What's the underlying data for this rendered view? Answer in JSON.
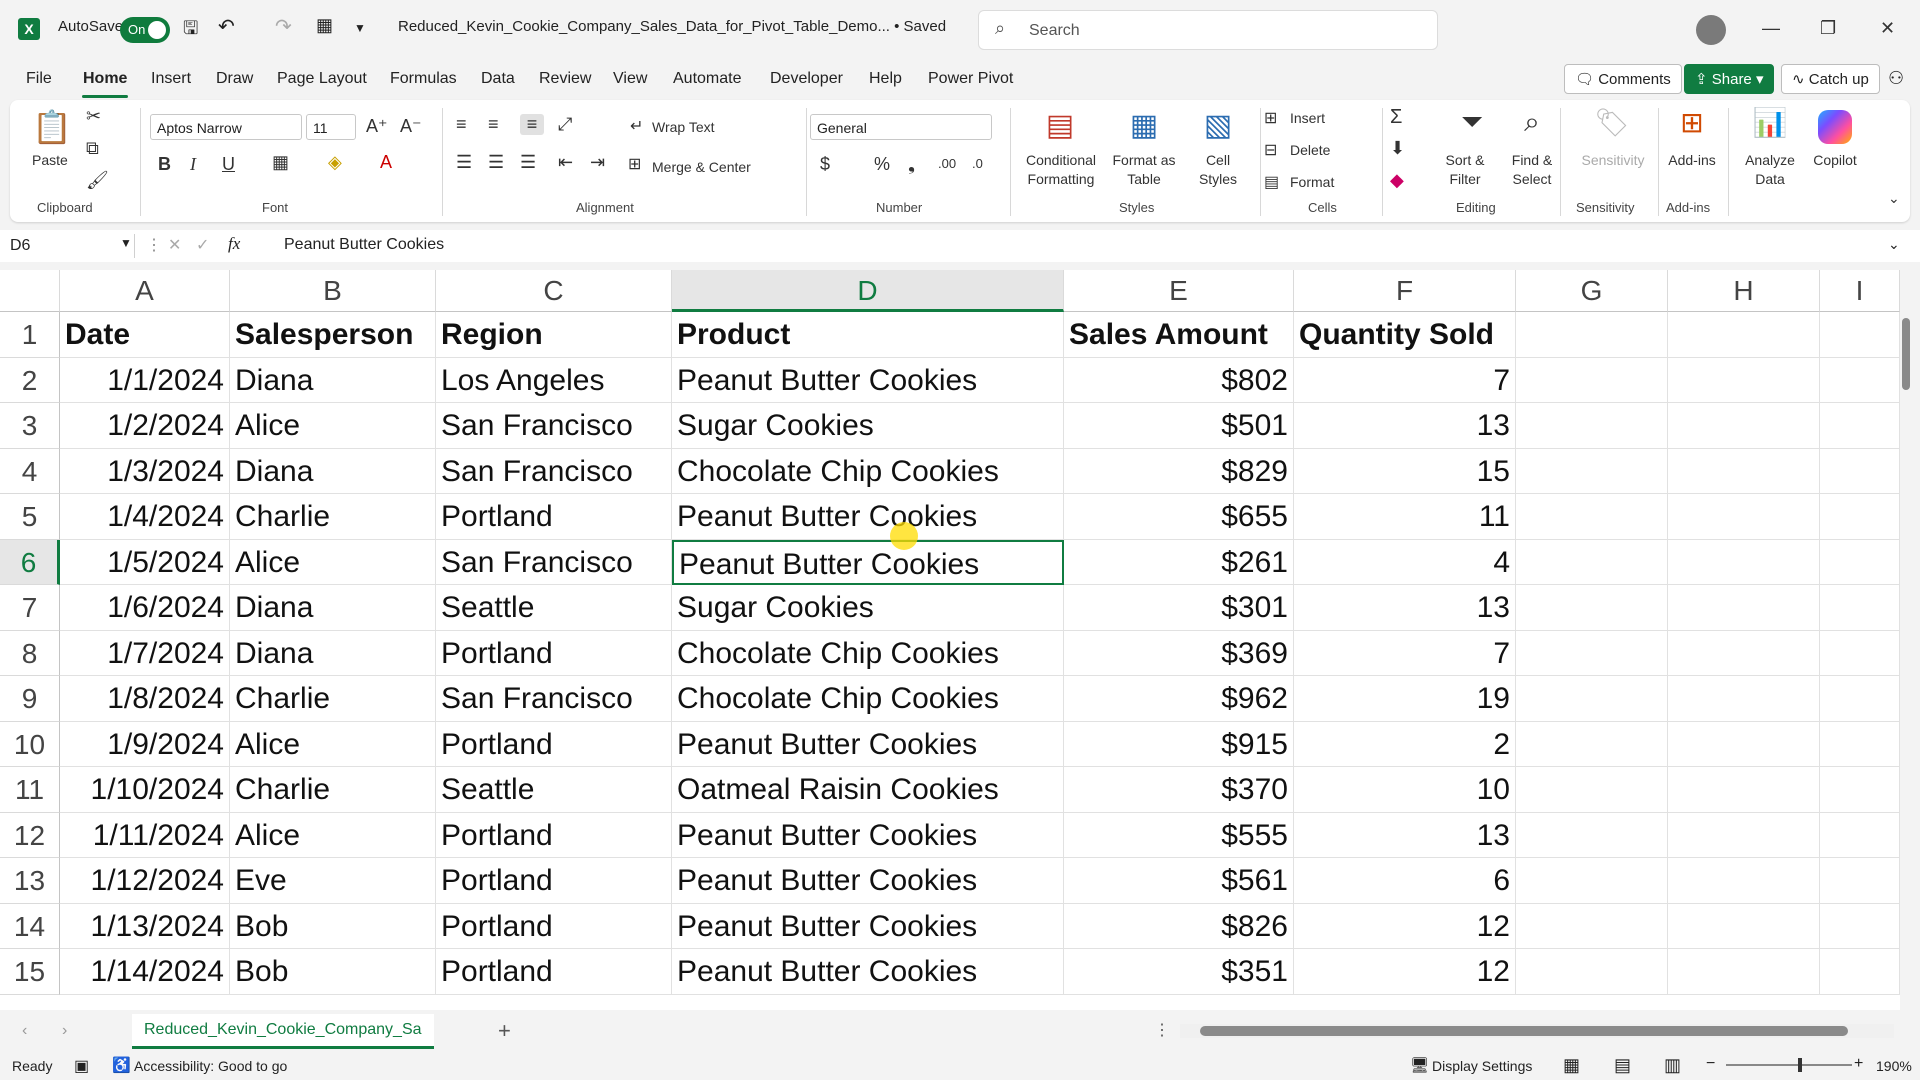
{
  "titlebar": {
    "autosave_label": "AutoSave",
    "autosave_state": "On",
    "document_title": "Reduced_Kevin_Cookie_Company_Sales_Data_for_Pivot_Table_Demo... • Saved",
    "search_placeholder": "Search"
  },
  "menu": {
    "items": [
      "File",
      "Home",
      "Insert",
      "Draw",
      "Page Layout",
      "Formulas",
      "Data",
      "Review",
      "View",
      "Automate",
      "Developer",
      "Help",
      "Power Pivot"
    ],
    "active": "Home",
    "comments": "Comments",
    "share": "Share",
    "catch_up": "Catch up"
  },
  "ribbon": {
    "clipboard": {
      "paste": "Paste",
      "group": "Clipboard"
    },
    "font": {
      "name": "Aptos Narrow",
      "size": "11",
      "group": "Font"
    },
    "alignment": {
      "wrap": "Wrap Text",
      "merge": "Merge & Center",
      "group": "Alignment"
    },
    "number": {
      "format": "General",
      "group": "Number"
    },
    "styles": {
      "cond_1": "Conditional",
      "cond_2": "Formatting",
      "fat_1": "Format as",
      "fat_2": "Table",
      "cell_1": "Cell",
      "cell_2": "Styles",
      "group": "Styles"
    },
    "cells": {
      "insert": "Insert",
      "delete": "Delete",
      "format": "Format",
      "group": "Cells"
    },
    "editing": {
      "sort_1": "Sort &",
      "sort_2": "Filter",
      "find_1": "Find &",
      "find_2": "Select",
      "group": "Editing"
    },
    "sensitivity": {
      "label": "Sensitivity",
      "group": "Sensitivity"
    },
    "addins": {
      "label": "Add-ins",
      "group": "Add-ins"
    },
    "analyze": {
      "l1": "Analyze",
      "l2": "Data"
    },
    "copilot": "Copilot"
  },
  "formula_bar": {
    "name_box": "D6",
    "fx": "fx",
    "content": "Peanut Butter Cookies"
  },
  "columns": [
    "A",
    "B",
    "C",
    "D",
    "E",
    "F",
    "G",
    "H",
    "I"
  ],
  "rows": [
    [
      "1",
      "Date",
      "Salesperson",
      "Region",
      "Product",
      "Sales Amount",
      "Quantity Sold"
    ],
    [
      "2",
      "1/1/2024",
      "Diana",
      "Los Angeles",
      "Peanut Butter Cookies",
      "$802",
      "7"
    ],
    [
      "3",
      "1/2/2024",
      "Alice",
      "San Francisco",
      "Sugar Cookies",
      "$501",
      "13"
    ],
    [
      "4",
      "1/3/2024",
      "Diana",
      "San Francisco",
      "Chocolate Chip Cookies",
      "$829",
      "15"
    ],
    [
      "5",
      "1/4/2024",
      "Charlie",
      "Portland",
      "Peanut Butter Cookies",
      "$655",
      "11"
    ],
    [
      "6",
      "1/5/2024",
      "Alice",
      "San Francisco",
      "Peanut Butter Cookies",
      "$261",
      "4"
    ],
    [
      "7",
      "1/6/2024",
      "Diana",
      "Seattle",
      "Sugar Cookies",
      "$301",
      "13"
    ],
    [
      "8",
      "1/7/2024",
      "Diana",
      "Portland",
      "Chocolate Chip Cookies",
      "$369",
      "7"
    ],
    [
      "9",
      "1/8/2024",
      "Charlie",
      "San Francisco",
      "Chocolate Chip Cookies",
      "$962",
      "19"
    ],
    [
      "10",
      "1/9/2024",
      "Alice",
      "Portland",
      "Peanut Butter Cookies",
      "$915",
      "2"
    ],
    [
      "11",
      "1/10/2024",
      "Charlie",
      "Seattle",
      "Oatmeal Raisin Cookies",
      "$370",
      "10"
    ],
    [
      "12",
      "1/11/2024",
      "Alice",
      "Portland",
      "Peanut Butter Cookies",
      "$555",
      "13"
    ],
    [
      "13",
      "1/12/2024",
      "Eve",
      "Portland",
      "Peanut Butter Cookies",
      "$561",
      "6"
    ],
    [
      "14",
      "1/13/2024",
      "Bob",
      "Portland",
      "Peanut Butter Cookies",
      "$826",
      "12"
    ],
    [
      "15",
      "1/14/2024",
      "Bob",
      "Portland",
      "Peanut Butter Cookies",
      "$351",
      "12"
    ]
  ],
  "sheet_tab": "Reduced_Kevin_Cookie_Company_Sa",
  "status": {
    "ready": "Ready",
    "accessibility": "Accessibility: Good to go",
    "display_settings": "Display Settings",
    "zoom": "190%"
  },
  "colors": {
    "accent": "#107c41"
  }
}
